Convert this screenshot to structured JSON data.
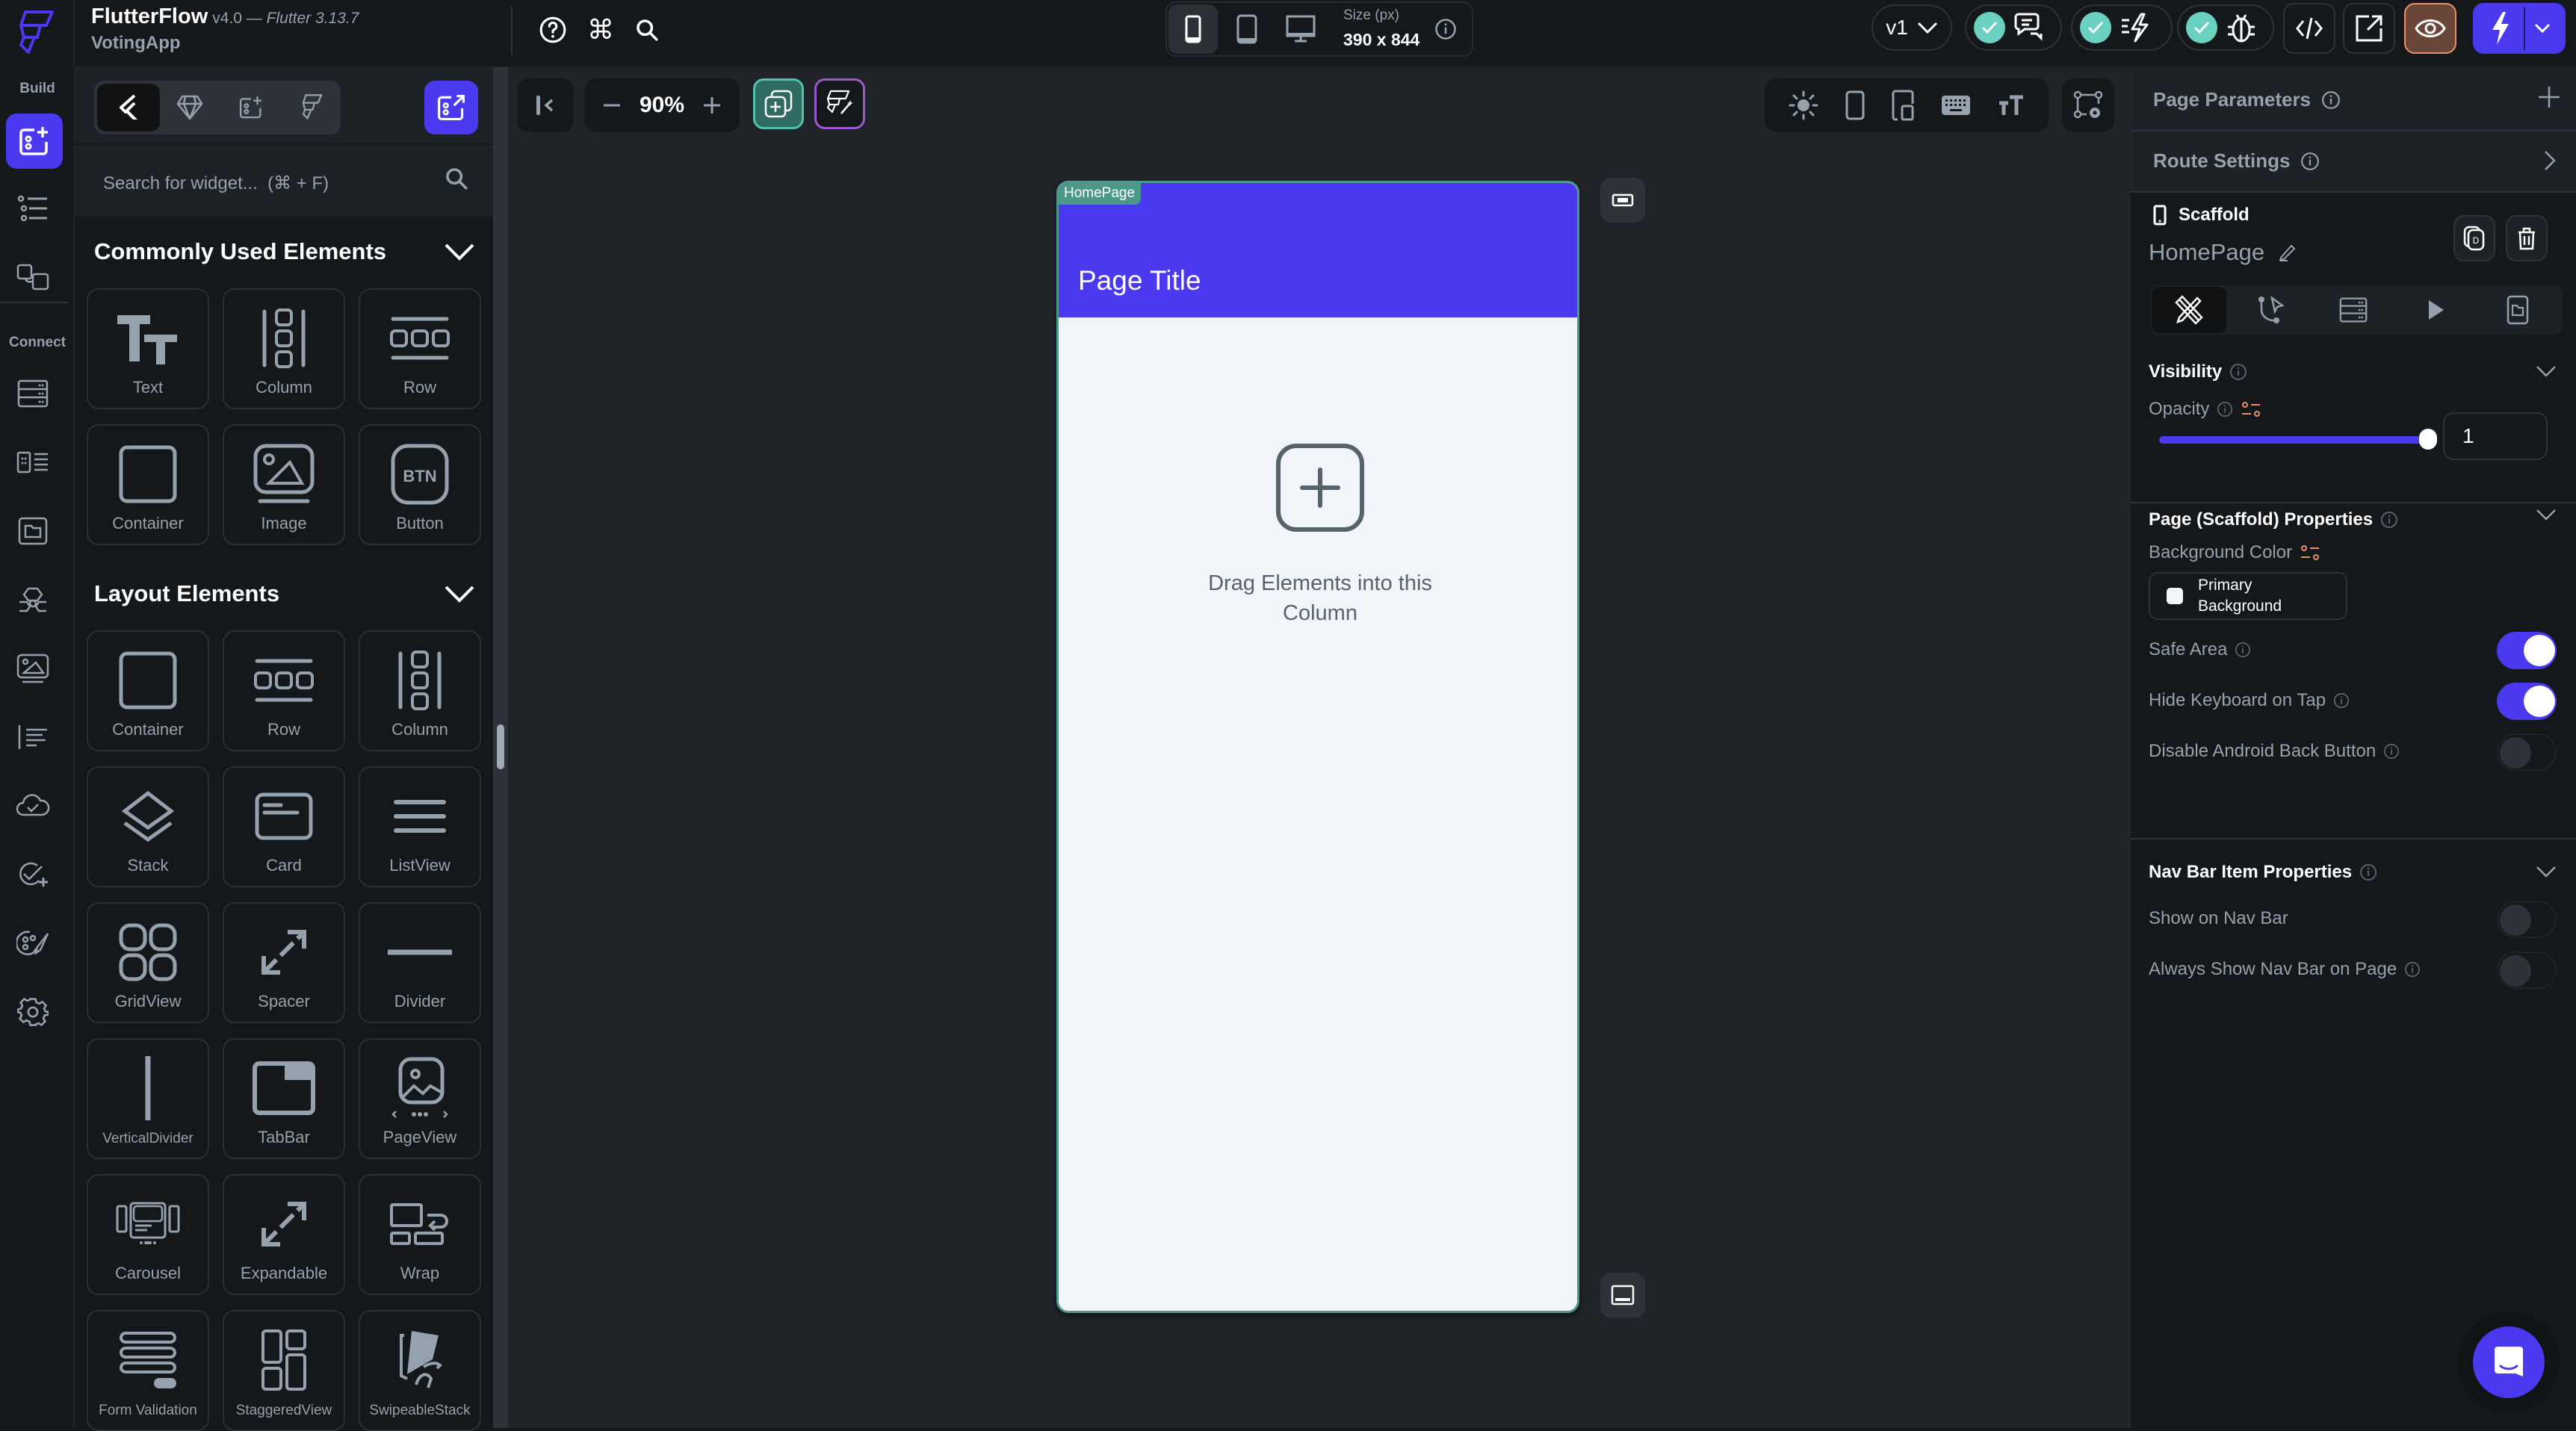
{
  "app": {
    "name": "FlutterFlow",
    "version": "v4.0 — ",
    "flutter_version": "Flutter 3.13.7",
    "project": "VotingApp"
  },
  "topbar": {
    "left_icons": [
      "help-icon",
      "command-icon",
      "search-icon"
    ],
    "device_size": {
      "label": "Size (px)",
      "value": "390 x 844"
    },
    "devices": [
      "phone",
      "tablet",
      "desktop"
    ],
    "active_device": "phone",
    "version_selector": "v1",
    "status_checks": [
      {
        "name": "comments",
        "ok": true
      },
      {
        "name": "performance",
        "ok": true
      },
      {
        "name": "debug",
        "ok": true
      }
    ],
    "buttons": [
      "view-code",
      "open-external",
      "preview",
      "run"
    ],
    "colors": {
      "check": "#6ad0c0",
      "preview_bg": "#6a4638",
      "preview_border": "#e8906a",
      "run_bg": "#4b39ef"
    }
  },
  "rail": {
    "build_label": "Build",
    "connect_label": "Connect",
    "build_items": [
      "widget-palette",
      "widget-tree",
      "storyboard"
    ],
    "connect_items": [
      "firestore",
      "data-types",
      "storage",
      "integrations",
      "media-assets",
      "app-values",
      "cloud-functions",
      "tests",
      "theme-settings",
      "settings"
    ]
  },
  "widget_panel": {
    "search_placeholder": "Search for widget...  (⌘ + F)",
    "sections": [
      {
        "title": "Commonly Used Elements",
        "items": [
          "Text",
          "Column",
          "Row",
          "Container",
          "Image",
          "Button"
        ]
      },
      {
        "title": "Layout Elements",
        "items": [
          "Container",
          "Row",
          "Column",
          "Stack",
          "Card",
          "ListView",
          "GridView",
          "Spacer",
          "Divider",
          "VerticalDivider",
          "TabBar",
          "PageView",
          "Carousel",
          "Expandable",
          "Wrap",
          "Form Validation",
          "StaggeredView",
          "SwipeableStack"
        ]
      }
    ]
  },
  "canvas": {
    "zoom": "90%",
    "page_badge": "HomePage",
    "page_title": "Page Title",
    "drop_hint": "Drag Elements into this Column",
    "colors": {
      "appbar": "#4b39ef",
      "page_bg": "#f1f4f8",
      "frame": "#4f998b"
    }
  },
  "right_panel": {
    "page_parameters": "Page Parameters",
    "route_settings": "Route Settings",
    "widget_type": "Scaffold",
    "widget_name": "HomePage",
    "tabs": [
      "properties",
      "actions",
      "backend-query",
      "animations",
      "widget-state"
    ],
    "visibility": {
      "title": "Visibility",
      "opacity_label": "Opacity",
      "opacity_value": "1",
      "opacity_fraction": 1.0
    },
    "scaffold": {
      "title": "Page (Scaffold) Properties",
      "bg_color_label": "Background Color",
      "bg_color_value": "Primary Background",
      "toggles": [
        {
          "label": "Safe Area",
          "on": true,
          "info": true
        },
        {
          "label": "Hide Keyboard on Tap",
          "on": true,
          "info": true
        },
        {
          "label": "Disable Android Back Button",
          "on": false,
          "info": true
        }
      ]
    },
    "nav_bar": {
      "title": "Nav Bar Item Properties",
      "toggles": [
        {
          "label": "Show on Nav Bar",
          "on": false,
          "info": false
        },
        {
          "label": "Always Show Nav Bar on Page",
          "on": false,
          "info": true
        }
      ]
    }
  }
}
